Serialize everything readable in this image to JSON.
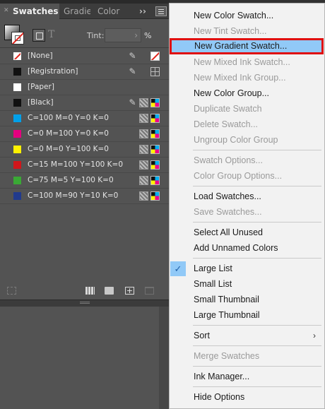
{
  "panel": {
    "tabs": [
      {
        "label": "Swatches",
        "active": true
      },
      {
        "label": "Gradient"
      },
      {
        "label": "Color"
      }
    ],
    "overflow_label": "››",
    "tint_label": "Tint:",
    "tint_value": "",
    "tint_unit": "%",
    "text_button": "T",
    "swatches": [
      {
        "name": "[None]",
        "color": "none"
      },
      {
        "name": "[Registration]",
        "color": "#111111"
      },
      {
        "name": "[Paper]",
        "color": "#ffffff"
      },
      {
        "name": "[Black]",
        "color": "#111111"
      },
      {
        "name": "C=100 M=0 Y=0 K=0",
        "color": "#00a0e9"
      },
      {
        "name": "C=0 M=100 Y=0 K=0",
        "color": "#e5007f"
      },
      {
        "name": "C=0 M=0 Y=100 K=0",
        "color": "#fff100"
      },
      {
        "name": "C=15 M=100 Y=100 K=0",
        "color": "#d0161b"
      },
      {
        "name": "C=75 M=5 Y=100 K=0",
        "color": "#3aa935"
      },
      {
        "name": "C=100 M=90 Y=10 K=0",
        "color": "#213a8d"
      }
    ]
  },
  "menu": {
    "items": [
      {
        "label": "New Color Swatch...",
        "enabled": true
      },
      {
        "label": "New Tint Swatch...",
        "enabled": false
      },
      {
        "label": "New Gradient Swatch...",
        "enabled": true,
        "highlighted": true
      },
      {
        "label": "New Mixed Ink Swatch...",
        "enabled": false
      },
      {
        "label": "New Mixed Ink Group...",
        "enabled": false
      },
      {
        "label": "New Color Group...",
        "enabled": true
      },
      {
        "label": "Duplicate Swatch",
        "enabled": false
      },
      {
        "label": "Delete Swatch...",
        "enabled": false
      },
      {
        "label": "Ungroup Color Group",
        "enabled": false
      },
      {
        "label": "Swatch Options...",
        "enabled": false
      },
      {
        "label": "Color Group Options...",
        "enabled": false
      },
      {
        "label": "Load Swatches...",
        "enabled": true
      },
      {
        "label": "Save Swatches...",
        "enabled": false
      },
      {
        "label": "Select All Unused",
        "enabled": true
      },
      {
        "label": "Add Unnamed Colors",
        "enabled": true
      },
      {
        "label": "Large List",
        "enabled": true,
        "checked": true
      },
      {
        "label": "Small List",
        "enabled": true
      },
      {
        "label": "Small Thumbnail",
        "enabled": true
      },
      {
        "label": "Large Thumbnail",
        "enabled": true
      },
      {
        "label": "Sort",
        "enabled": true,
        "submenu": true
      },
      {
        "label": "Merge Swatches",
        "enabled": false
      },
      {
        "label": "Ink Manager...",
        "enabled": true
      },
      {
        "label": "Hide Options",
        "enabled": true
      }
    ],
    "check_glyph": "✓",
    "submenu_glyph": "›"
  }
}
